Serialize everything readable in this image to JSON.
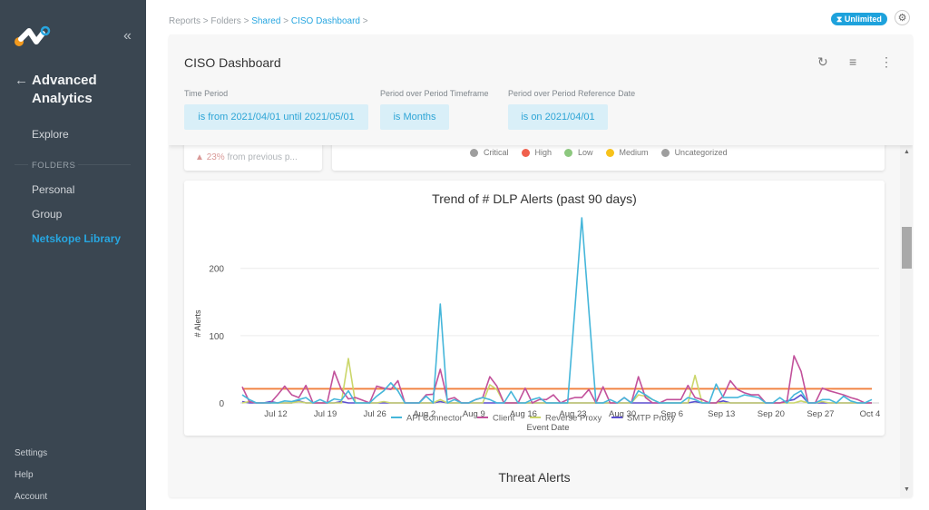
{
  "sidebar": {
    "app_title_line1": "Advanced",
    "app_title_line2": "Analytics",
    "explore": "Explore",
    "folders_label": "FOLDERS",
    "items": [
      {
        "label": "Personal"
      },
      {
        "label": "Group"
      },
      {
        "label": "Netskope Library",
        "active": true
      }
    ],
    "bottom": [
      {
        "label": "Settings"
      },
      {
        "label": "Help"
      },
      {
        "label": "Account"
      }
    ],
    "collapse_icon": "«",
    "back_icon": "←"
  },
  "breadcrumb": {
    "items": [
      "Reports",
      "Folders",
      "Shared",
      "CISO Dashboard"
    ],
    "separator": ">"
  },
  "topbar": {
    "badge": "Unlimited",
    "badge_icon": "⧗",
    "gear_icon": "⚙"
  },
  "dashboard": {
    "title": "CISO Dashboard",
    "icons": {
      "refresh": "↻",
      "filter": "≡",
      "more": "⋮"
    },
    "filters": [
      {
        "label": "Time Period",
        "value": "is from 2021/04/01 until 2021/05/01"
      },
      {
        "label": "Period over Period Timeframe",
        "value": "is Months"
      },
      {
        "label": "Period over Period Reference Date",
        "value": "is on 2021/04/01"
      }
    ]
  },
  "scorecard": {
    "delta_arrow": "▲",
    "delta_pct": "23%",
    "delta_text": "from previous p..."
  },
  "severity_legend": [
    {
      "label": "Critical",
      "color": "#9e9e9e"
    },
    {
      "label": "High",
      "color": "#f0604d"
    },
    {
      "label": "Low",
      "color": "#8dc87f"
    },
    {
      "label": "Medium",
      "color": "#f7c21b"
    },
    {
      "label": "Uncategorized",
      "color": "#9e9e9e"
    }
  ],
  "next_section": {
    "title": "Threat Alerts"
  },
  "chart_data": {
    "type": "line",
    "title": "Trend of # DLP Alerts (past 90 days)",
    "xlabel": "Event Date",
    "ylabel": "# Alerts",
    "x_start": "Jul 7",
    "x_end": "Oct 4",
    "x_tick_labels": [
      "Jul 12",
      "Jul 19",
      "Jul 26",
      "Aug 2",
      "Aug 9",
      "Aug 16",
      "Aug 23",
      "Aug 30",
      "Sep 6",
      "Sep 13",
      "Sep 20",
      "Sep 27",
      "Oct 4"
    ],
    "x_tick_day_index": [
      5,
      12,
      19,
      26,
      33,
      40,
      47,
      54,
      61,
      68,
      75,
      82,
      89
    ],
    "y_ticks": [
      0,
      100,
      200
    ],
    "ylim": [
      0,
      290
    ],
    "grid": true,
    "legend_position": "bottom",
    "reference_line": {
      "value": 21,
      "color": "#f07f3c"
    },
    "series": [
      {
        "name": "API Connector",
        "color": "#45b6da",
        "values": [
          12,
          5,
          0,
          0,
          0,
          0,
          3,
          2,
          5,
          8,
          0,
          5,
          0,
          6,
          4,
          18,
          0,
          0,
          0,
          10,
          18,
          30,
          18,
          0,
          0,
          0,
          10,
          0,
          147,
          0,
          5,
          0,
          0,
          5,
          8,
          5,
          0,
          0,
          17,
          0,
          0,
          5,
          8,
          0,
          0,
          0,
          0,
          137,
          275,
          137,
          0,
          0,
          5,
          0,
          8,
          0,
          18,
          12,
          5,
          0,
          0,
          0,
          0,
          8,
          5,
          0,
          0,
          28,
          8,
          8,
          8,
          12,
          10,
          8,
          0,
          0,
          8,
          0,
          12,
          18,
          0,
          0,
          5,
          5,
          0,
          10,
          3,
          0,
          0,
          5
        ]
      },
      {
        "name": "Client",
        "color": "#c2519b",
        "values": [
          24,
          2,
          0,
          0,
          0,
          12,
          25,
          12,
          8,
          26,
          0,
          0,
          0,
          47,
          20,
          6,
          8,
          4,
          0,
          25,
          22,
          20,
          33,
          0,
          0,
          0,
          12,
          13,
          50,
          5,
          8,
          0,
          0,
          5,
          8,
          39,
          25,
          0,
          0,
          0,
          22,
          0,
          5,
          5,
          12,
          0,
          5,
          8,
          8,
          20,
          0,
          24,
          0,
          0,
          8,
          0,
          39,
          8,
          0,
          0,
          5,
          5,
          5,
          26,
          8,
          5,
          0,
          0,
          10,
          33,
          20,
          15,
          12,
          12,
          0,
          0,
          0,
          2,
          70,
          47,
          0,
          0,
          22,
          18,
          15,
          12,
          8,
          5,
          0,
          0
        ]
      },
      {
        "name": "Reverse Proxy",
        "color": "#cbd66a",
        "values": [
          0,
          2,
          0,
          0,
          0,
          0,
          0,
          0,
          2,
          0,
          0,
          0,
          0,
          0,
          0,
          66,
          0,
          0,
          0,
          0,
          2,
          0,
          0,
          0,
          0,
          0,
          0,
          0,
          5,
          0,
          0,
          0,
          0,
          0,
          0,
          27,
          20,
          0,
          0,
          0,
          0,
          0,
          0,
          0,
          0,
          0,
          0,
          0,
          0,
          0,
          0,
          0,
          0,
          0,
          0,
          0,
          12,
          10,
          5,
          0,
          0,
          0,
          0,
          0,
          41,
          0,
          0,
          0,
          0,
          0,
          0,
          0,
          0,
          0,
          0,
          0,
          0,
          0,
          0,
          3,
          0,
          0,
          2,
          0,
          0,
          0,
          0,
          0,
          0,
          0
        ]
      },
      {
        "name": "SMTP Proxy",
        "color": "#5b4fcf",
        "values": [
          2,
          0,
          0,
          0,
          2,
          0,
          0,
          0,
          3,
          0,
          0,
          0,
          0,
          0,
          2,
          0,
          0,
          0,
          0,
          0,
          0,
          0,
          0,
          0,
          0,
          0,
          0,
          0,
          2,
          0,
          0,
          0,
          0,
          0,
          0,
          0,
          0,
          0,
          0,
          0,
          0,
          0,
          0,
          0,
          0,
          0,
          0,
          0,
          0,
          0,
          0,
          0,
          0,
          0,
          0,
          0,
          0,
          0,
          0,
          0,
          0,
          0,
          0,
          0,
          2,
          0,
          0,
          0,
          3,
          0,
          0,
          0,
          0,
          0,
          0,
          0,
          0,
          3,
          5,
          12,
          0,
          0,
          0,
          0,
          0,
          0,
          0,
          0,
          0,
          0
        ]
      }
    ]
  }
}
